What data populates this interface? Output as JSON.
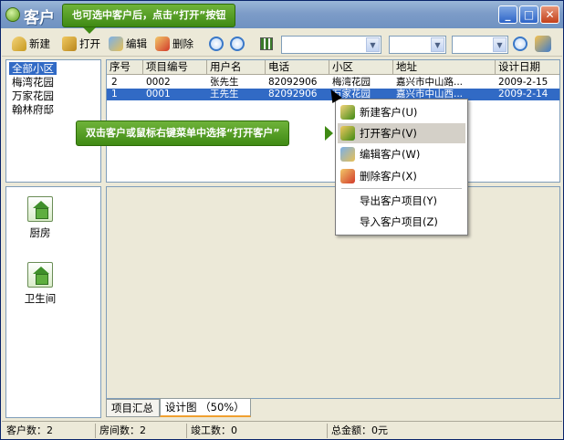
{
  "window": {
    "title": "客户",
    "controls": {
      "minimize": "_",
      "maximize": "□",
      "close": "✕"
    }
  },
  "callouts": {
    "top": "也可选中客户后，点击“打开”按钮",
    "middle": "双击客户或鼠标右键菜单中选择“打开客户”"
  },
  "toolbar": {
    "new_label": "新建",
    "open_label": "打开",
    "edit_label": "编辑",
    "delete_label": "删除",
    "combo_arrow": "▼"
  },
  "communities": {
    "items": [
      "全部小区",
      "梅湾花园",
      "万家花园",
      "翰林府邸"
    ],
    "selected_index": 0
  },
  "customers": {
    "columns": [
      "序号",
      "项目编号",
      "用户名",
      "电话",
      "小区",
      "地址",
      "设计日期"
    ],
    "rows": [
      [
        "2",
        "0002",
        "张先生",
        "82092906",
        "梅湾花园",
        "嘉兴市中山路...",
        "2009-2-15"
      ],
      [
        "1",
        "0001",
        "王先生",
        "82092906",
        "万家花园",
        "嘉兴市中山西...",
        "2009-2-14"
      ]
    ],
    "selected_row": 1
  },
  "rooms": [
    "厨房",
    "卫生间"
  ],
  "tabs": [
    {
      "label": "项目汇总",
      "active": false
    },
    {
      "label": "设计图 （50%）",
      "active": true
    }
  ],
  "context_menu": {
    "items": [
      {
        "label": "新建客户(U)",
        "icon": "new-customer-icon"
      },
      {
        "label": "打开客户(V)",
        "icon": "open-customer-icon",
        "hover": true
      },
      {
        "label": "编辑客户(W)",
        "icon": "edit-customer-icon"
      },
      {
        "label": "删除客户(X)",
        "icon": "delete-customer-icon"
      },
      {
        "label": "导出客户项目(Y)"
      },
      {
        "label": "导入客户项目(Z)"
      }
    ]
  },
  "status": {
    "customers": "客户数：2",
    "rooms": "房间数：2",
    "completed": "竣工数：0",
    "total": "总金额：0元"
  },
  "colors": {
    "selection": "#316ac5",
    "callout_green": "#4f9a22",
    "title_bar": "#7d9cc8"
  }
}
